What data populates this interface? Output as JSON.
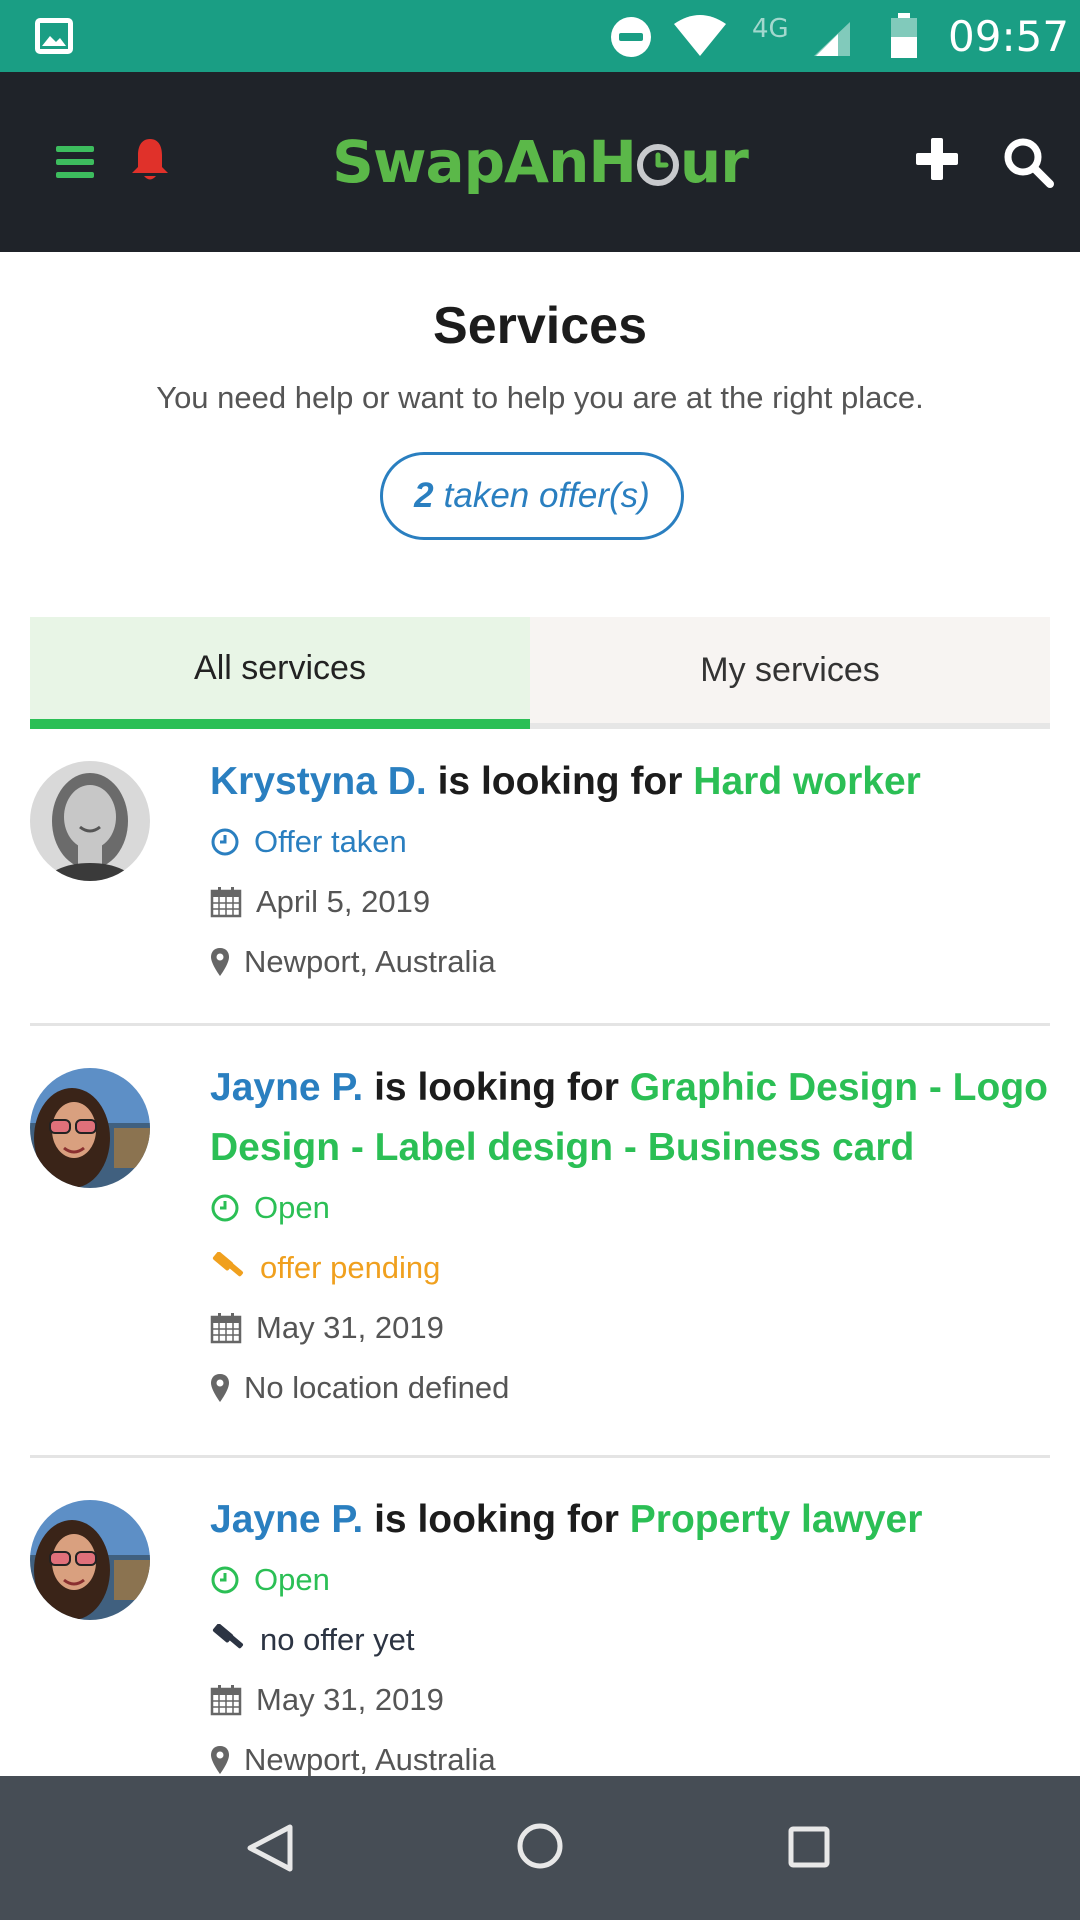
{
  "status_bar": {
    "network": "4G",
    "time": "09:57"
  },
  "app_bar": {
    "logo_part1": "SwapAn",
    "logo_part2": "H",
    "logo_part3": "ur"
  },
  "header": {
    "title": "Services",
    "subtitle": "You need help or want to help you are at the right place.",
    "taken_count": "2",
    "taken_label": "taken offer(s)"
  },
  "tabs": [
    {
      "label": "All services",
      "active": true
    },
    {
      "label": "My services",
      "active": false
    }
  ],
  "services": [
    {
      "name": "Krystyna D.",
      "verb": "is looking for",
      "service": "Hard worker",
      "status": "Offer taken",
      "date": "April 5, 2019",
      "location": "Newport, Australia"
    },
    {
      "name": "Jayne P.",
      "verb": "is looking for",
      "service": "Graphic Design - Logo Design - Label design - Business card",
      "status": "Open",
      "offer": "offer pending",
      "date": "May 31, 2019",
      "location": "No location defined"
    },
    {
      "name": "Jayne P.",
      "verb": "is looking for",
      "service": "Property lawyer",
      "status": "Open",
      "offer": "no offer yet",
      "date": "May 31, 2019",
      "location": "Newport, Australia"
    }
  ],
  "colors": {
    "status_bar": "#1a9e84",
    "app_bar": "#1f2329",
    "link_blue": "#2a7fc0",
    "accent_green": "#2bbf55",
    "pending_orange": "#f0a01e",
    "nav_bar": "#464d55"
  }
}
